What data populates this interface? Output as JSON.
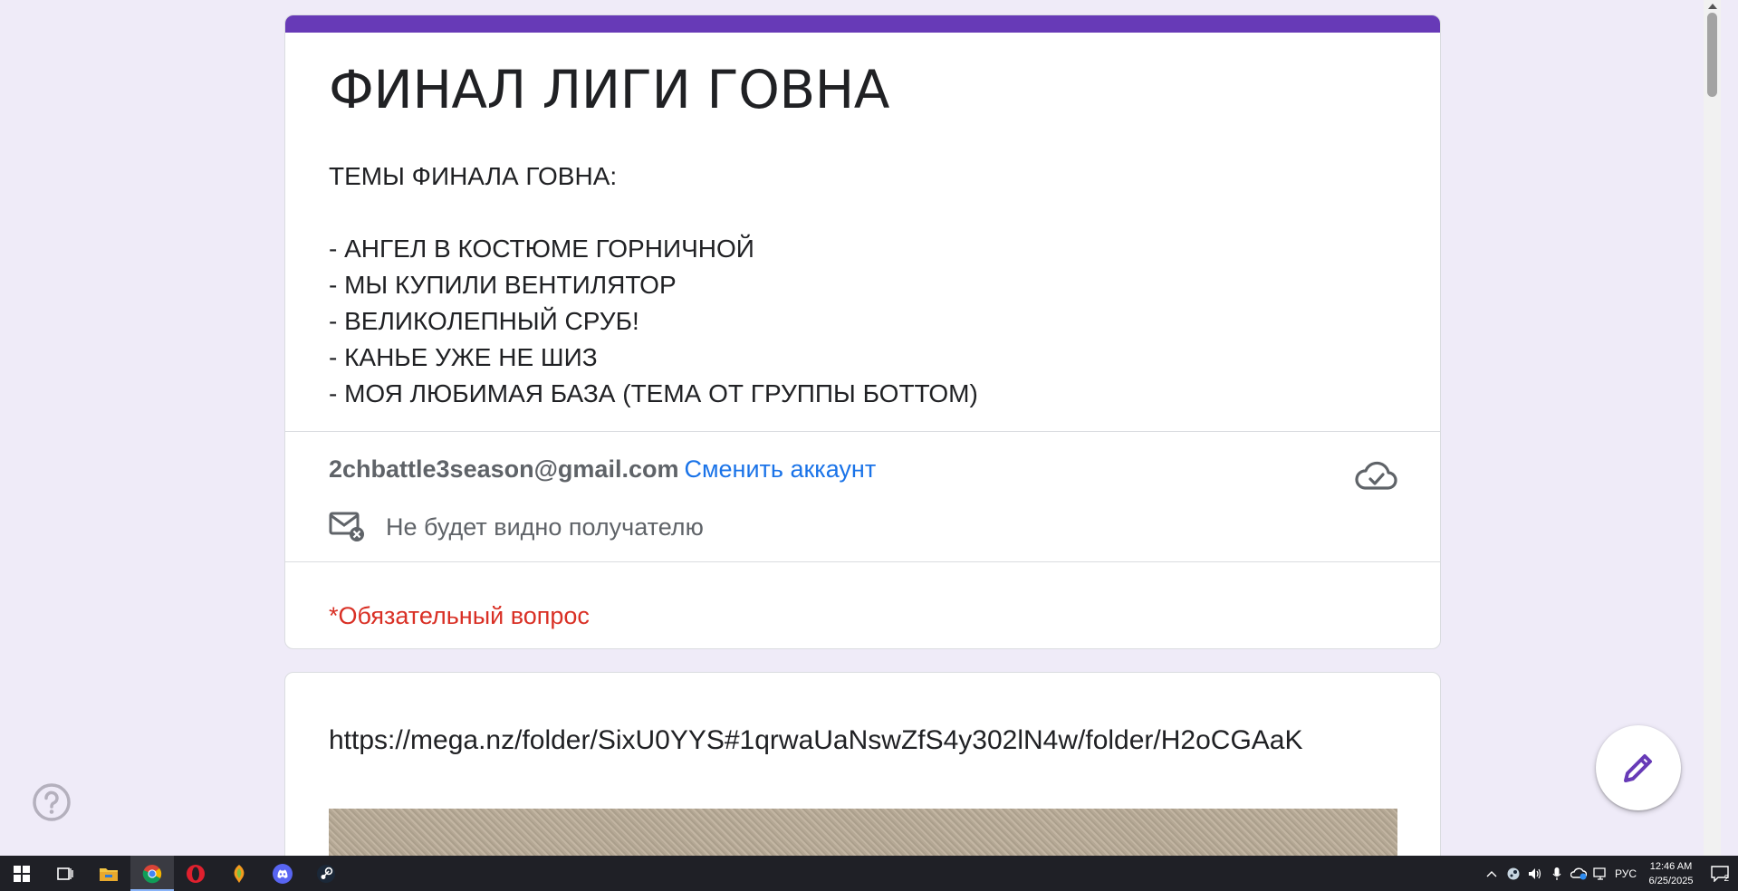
{
  "form": {
    "title": "ФИНАЛ ЛИГИ ГОВНА",
    "description_lines": [
      "ТЕМЫ ФИНАЛА ГОВНА:",
      "",
      "- АНГЕЛ В КОСТЮМЕ ГОРНИЧНОЙ",
      "- МЫ КУПИЛИ ВЕНТИЛЯТОР",
      "- ВЕЛИКОЛЕПНЫЙ СРУБ!",
      "- КАНЬЕ УЖЕ НЕ ШИЗ",
      "- МОЯ ЛЮБИМАЯ БАЗА (ТЕМА ОТ ГРУППЫ БОТТОМ)"
    ],
    "accent_color": "#673ab7",
    "account_email": "2chbattle3season@gmail.com",
    "switch_account_label": "Сменить аккаунт",
    "saved_icon": "cloud-check-icon",
    "privacy_icon": "mail-hidden-icon",
    "privacy_note": "Не будет видно получателю",
    "required_note": "*Обязательный вопрос",
    "required_color": "#d93025"
  },
  "media": {
    "link_text": "https://mega.nz/folder/SixU0YYS#1qrwaUaNswZfS4y302lN4w/folder/H2oCGAaK"
  },
  "floating": {
    "help_icon": "help-circle-icon",
    "edit_icon": "pencil-icon"
  },
  "taskbar": {
    "apps": [
      "windows-start-icon",
      "task-view-icon",
      "file-explorer-icon",
      "chrome-icon",
      "opera-icon",
      "fl-studio-icon",
      "discord-icon",
      "steam-icon"
    ],
    "active_app": "chrome-icon",
    "language": "РУС",
    "time": "12:46 AM",
    "date": "6/25/2025",
    "notification_count": "2"
  }
}
